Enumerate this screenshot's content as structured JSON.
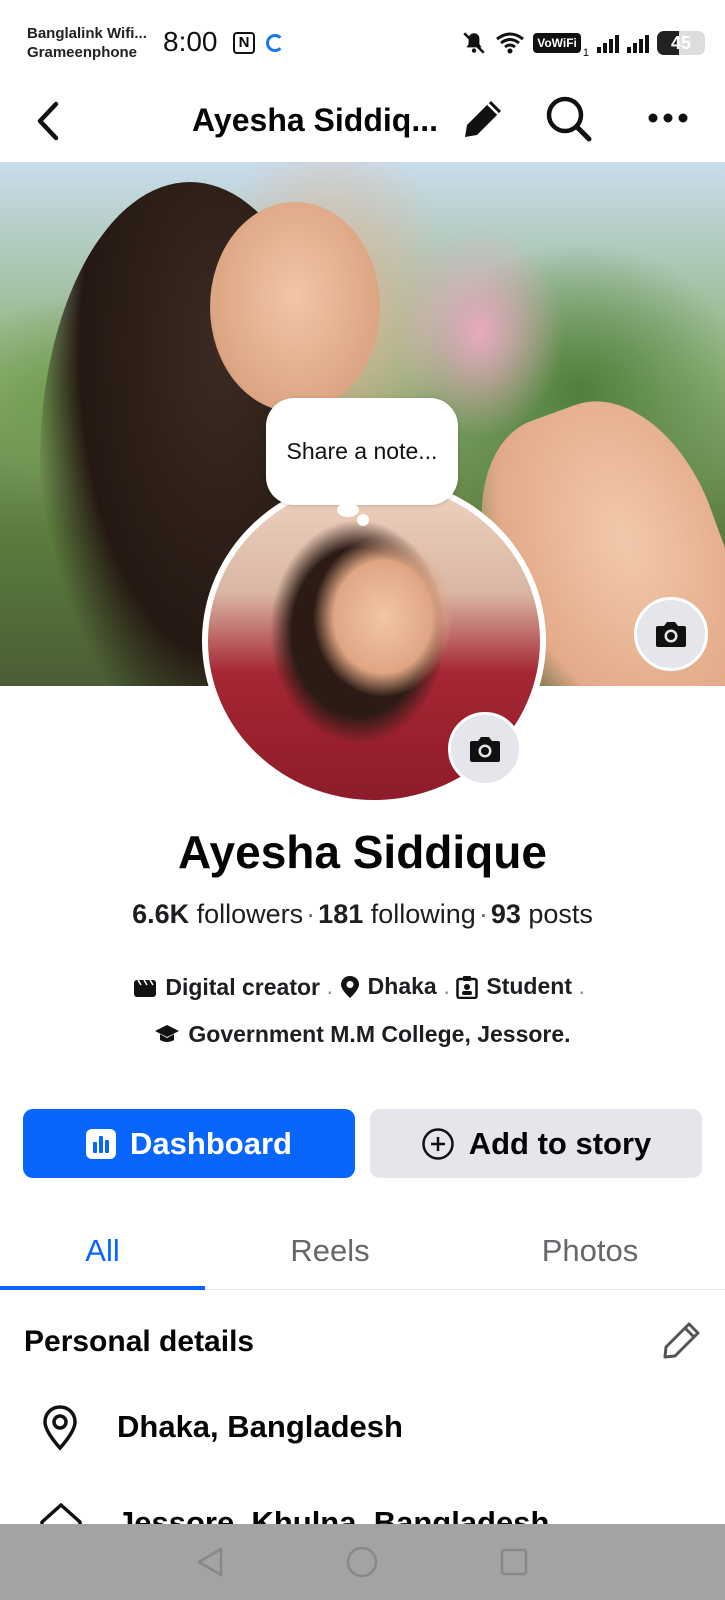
{
  "status_bar": {
    "carrier_1": "Banglalink Wifi...",
    "carrier_2": "Grameenphone",
    "time": "8:00",
    "nfc": "N",
    "vowifi": "VoWiFi",
    "sim_index": "1",
    "battery_level": "45",
    "battery_fraction": 0.45
  },
  "app_bar": {
    "title": "Ayesha Siddiq...",
    "icons": [
      "back-icon",
      "pencil-icon",
      "search-icon",
      "more-icon"
    ]
  },
  "note": {
    "placeholder": "Share a note..."
  },
  "profile": {
    "name": "Ayesha Siddique",
    "followers_count": "6.6K",
    "followers_label": "followers",
    "following_count": "181",
    "following_label": "following",
    "posts_count": "93",
    "posts_label": "posts",
    "bio": {
      "category": "Digital creator",
      "location": "Dhaka",
      "occupation": "Student",
      "education": "Government M.M College, Jessore."
    }
  },
  "actions": {
    "dashboard_label": "Dashboard",
    "add_story_label": "Add to story"
  },
  "tabs": [
    {
      "label": "All",
      "active": true
    },
    {
      "label": "Reels",
      "active": false
    },
    {
      "label": "Photos",
      "active": false
    }
  ],
  "personal_details": {
    "title": "Personal details",
    "items": [
      {
        "icon": "location-pin-icon",
        "text": "Dhaka, Bangladesh"
      },
      {
        "icon": "home-icon",
        "text": "Jessore, Khulna, Bangladesh"
      }
    ]
  },
  "colors": {
    "accent": "#0866ff",
    "secondary_button": "#e4e6eb",
    "muted_text": "#65676b",
    "nav_bar": "#a3a3a3"
  }
}
